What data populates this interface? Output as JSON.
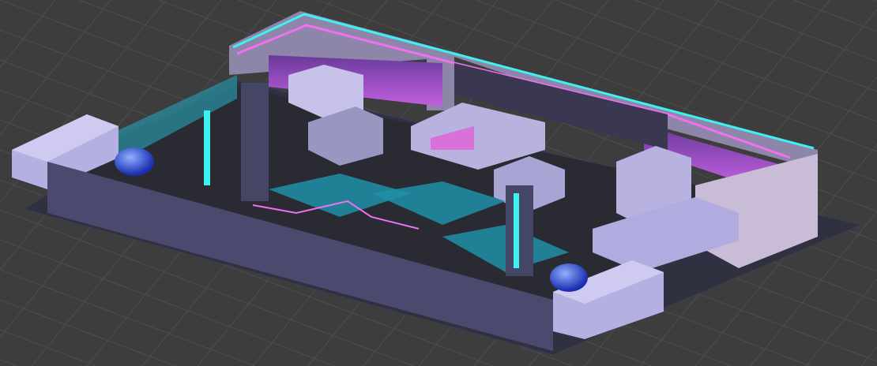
{
  "scene": {
    "colors": {
      "background": "#3d3d3d",
      "grid": "#4c4c4c",
      "floor": "#2e2f3c",
      "wall_dark": "#4b4a6e",
      "wall_light": "#b4b0e2",
      "wall_pale": "#c9bcd6",
      "neon_cyan": "#3ff0f0",
      "neon_pink": "#f070f0",
      "pool": "#1f8fa8",
      "orb": "#2f55e0"
    }
  }
}
